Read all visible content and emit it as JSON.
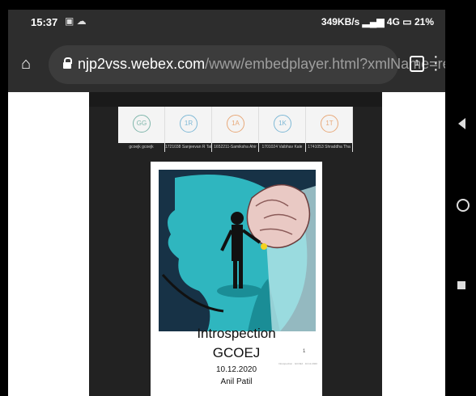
{
  "status_bar": {
    "time": "15:37",
    "speed": "349KB/s",
    "network": "4G",
    "battery": "21%"
  },
  "browser": {
    "url_host": "njp2vss.webex.com",
    "url_path": "/www/embedplayer.html?xmlName=recording.xml",
    "tab_count": "1"
  },
  "participants": [
    {
      "initials": "GG",
      "name": "gcoejk gcoejk",
      "color": "#7fb6ab"
    },
    {
      "initials": "1R",
      "name": "1721038 Sanjeevan R Tak",
      "color": "#7fb9d6"
    },
    {
      "initials": "1A",
      "name": "1652211-Samiksha Ahir",
      "color": "#e8a97a"
    },
    {
      "initials": "1K",
      "name": "1701024 Vaibhav Kale",
      "color": "#7fb9d6"
    },
    {
      "initials": "1T",
      "name": "1741053 Shraddha Tha",
      "color": "#e8a97a"
    }
  ],
  "slide": {
    "title": "Introspection",
    "subtitle": "GCOEJ",
    "date": "10.12.2020",
    "presenter": "Anil Patil",
    "page_number": "1",
    "footnote": "Introspection · GCOEJ · 10.12.2020"
  }
}
